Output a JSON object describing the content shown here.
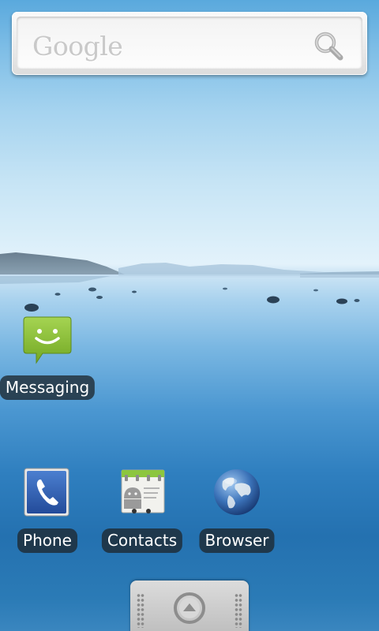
{
  "search_widget": {
    "logo_text": "Google",
    "icon": "search-icon"
  },
  "shortcuts": [
    {
      "label": "Messaging",
      "icon": "messaging-icon",
      "color": "#8cc63f"
    },
    {
      "label": "Phone",
      "icon": "phone-icon",
      "color": "#2e5db3"
    },
    {
      "label": "Contacts",
      "icon": "contacts-icon",
      "color": "#8cc63f"
    },
    {
      "label": "Browser",
      "icon": "globe-icon",
      "color": "#2d5f9e"
    }
  ],
  "dock": {
    "icon": "launcher-arrow-up-icon"
  },
  "wallpaper": {
    "sky_color": "#7dbde6",
    "water_color": "#2471b0"
  }
}
